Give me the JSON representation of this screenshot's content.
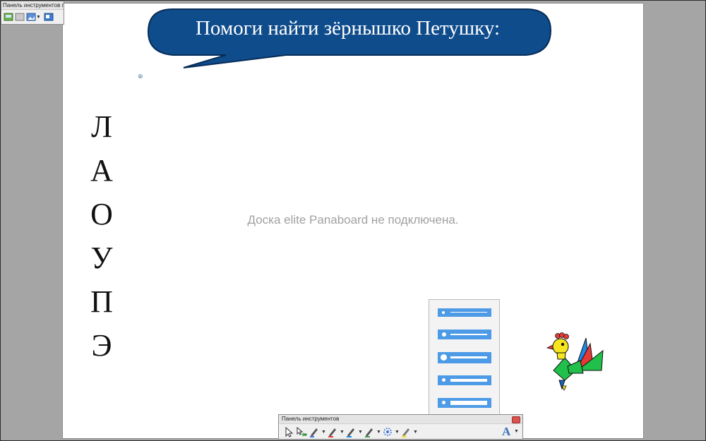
{
  "mini_toolbar": {
    "title": "Панель инструментов п..."
  },
  "bubble": {
    "text": "Помоги найти зёрнышко Петушку:"
  },
  "letters": [
    "Л",
    "А",
    "О",
    "У",
    "П",
    "Э"
  ],
  "status": {
    "message": "Доска elite Panaboard не подключена."
  },
  "tool_panel": {
    "title": "Панель инструментов",
    "font_button": "A"
  },
  "colors": {
    "bubble": "#0f4c8c",
    "accent": "#4d9be6",
    "background": "#a5a5a5"
  },
  "icons": [
    "arrow-pointer-icon",
    "selection-icon",
    "pen-icon",
    "red-pen-icon",
    "blue-pen-icon",
    "green-pen-icon",
    "eraser-icon",
    "highlighter-icon",
    "line-width-icon",
    "font-icon",
    "close-icon",
    "rooster-icon"
  ]
}
